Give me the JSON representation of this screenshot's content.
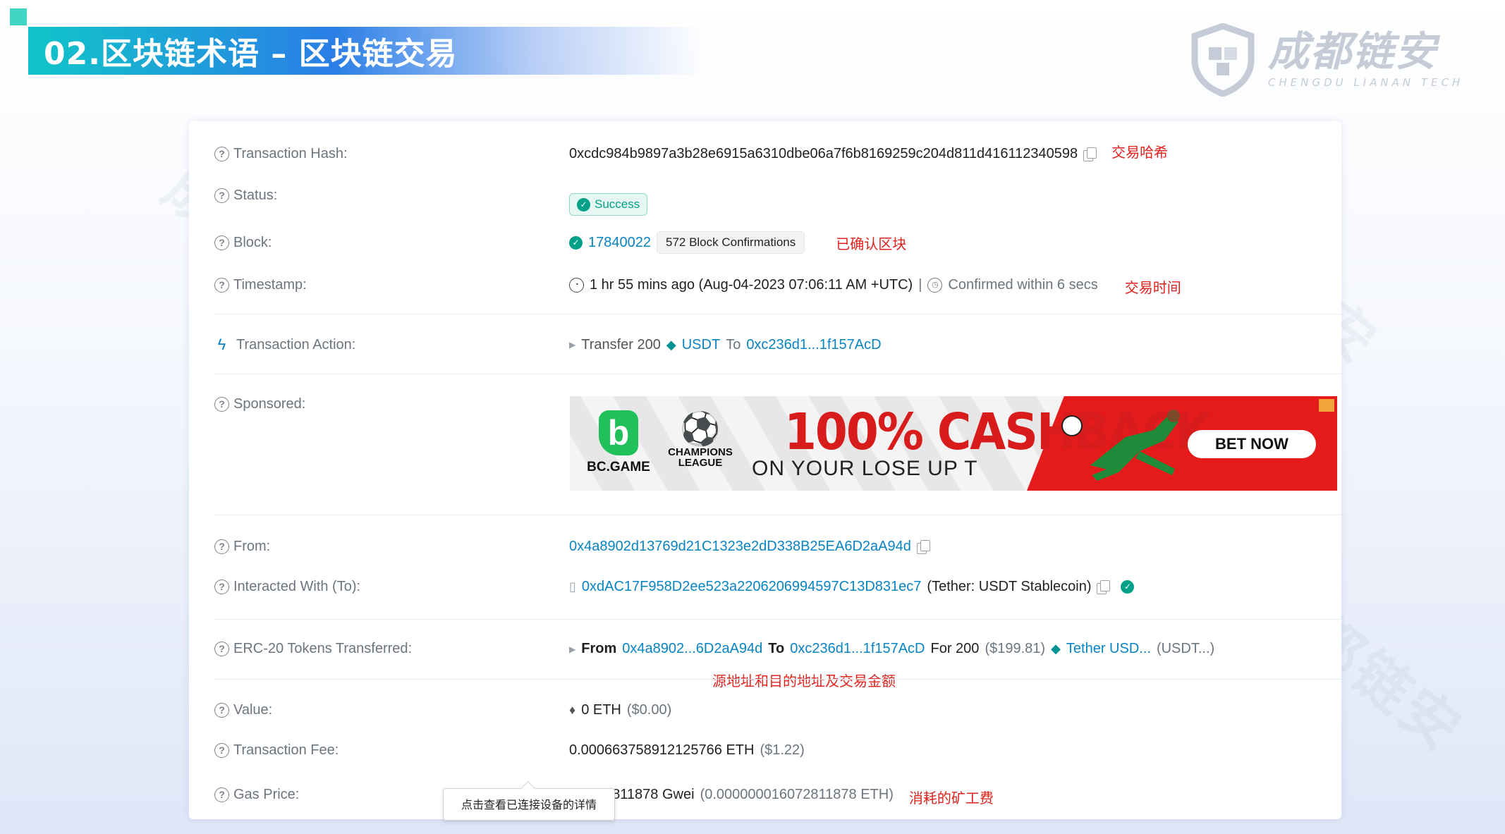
{
  "slide": {
    "title": "02.区块链术语 – 区块链交易"
  },
  "logo": {
    "name_cn": "成都链安",
    "name_en": "CHENGDU LIANAN TECH"
  },
  "watermark_text": "成都链安",
  "tx": {
    "hash": {
      "label": "Transaction Hash:",
      "value": "0xcdc984b9897a3b28e6915a6310dbe06a7f6b8169259c204d811d416112340598",
      "note": "交易哈希"
    },
    "status": {
      "label": "Status:",
      "value": "Success"
    },
    "block": {
      "label": "Block:",
      "number": "17840022",
      "confirmations": "572 Block Confirmations",
      "note": "已确认区块"
    },
    "timestamp": {
      "label": "Timestamp:",
      "value": "1 hr 55 mins ago (Aug-04-2023 07:06:11 AM +UTC)",
      "sep": "|",
      "confirmed": "Confirmed within 6 secs",
      "note": "交易时间"
    },
    "action": {
      "label": "Transaction Action:",
      "prefix": "Transfer 200",
      "token": "USDT",
      "to_word": "To",
      "to_addr": "0xc236d1...1f157AcD"
    },
    "sponsored": {
      "label": "Sponsored:"
    },
    "from": {
      "label": "From:",
      "value": "0x4a8902d13769d21C1323e2dD338B25EA6D2aA94d"
    },
    "to": {
      "label": "Interacted With (To):",
      "value": "0xdAC17F958D2ee523a2206206994597C13D831ec7",
      "name": "(Tether: USDT Stablecoin)"
    },
    "erc20": {
      "label": "ERC-20 Tokens Transferred:",
      "from_word": "From",
      "from_addr": "0x4a8902...6D2aA94d",
      "to_word": "To",
      "to_addr": "0xc236d1...1f157AcD",
      "for_text": "For 200",
      "usd": "($199.81)",
      "token_name": "Tether USD...",
      "token_symbol": "(USDT...)",
      "note": "源地址和目的地址及交易金额"
    },
    "value": {
      "label": "Value:",
      "amount": "0 ETH",
      "usd": "($0.00)"
    },
    "fee": {
      "label": "Transaction Fee:",
      "amount": "0.000663758912125766 ETH",
      "usd": "($1.22)"
    },
    "gas": {
      "label": "Gas Price:",
      "amount": "16.072811878 Gwei",
      "eth": "(0.000000016072811878 ETH)",
      "note": "消耗的矿工费"
    }
  },
  "ad": {
    "brand": "BC.GAME",
    "partner": "CHAMPIONS LEAGUE",
    "headline": "100% CASHBACK",
    "subline": "ON YOUR LOSE UP T",
    "cta": "BET NOW"
  },
  "tooltip": "点击查看已连接设备的详情",
  "colors": {
    "accent": "#0784c3",
    "success": "#00a186",
    "note": "#e0221c",
    "ad_red": "#e51b1b"
  }
}
